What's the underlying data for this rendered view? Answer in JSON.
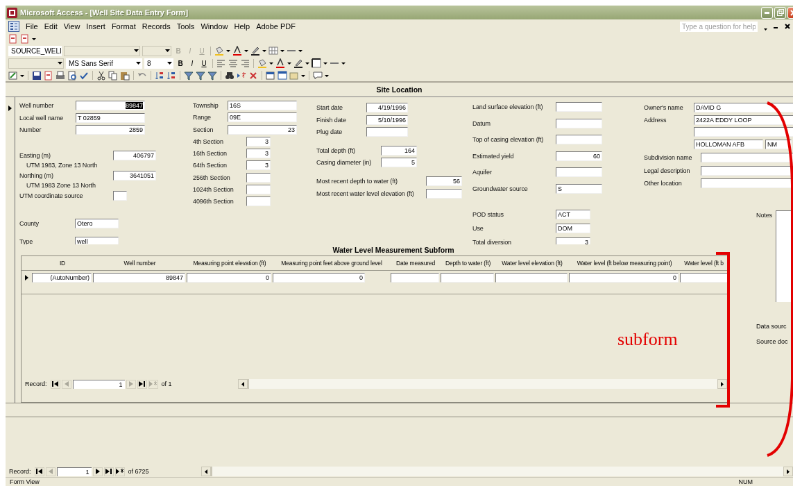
{
  "window": {
    "title": "Microsoft Access - [Well Site Data Entry Form]"
  },
  "menu": [
    {
      "label": "File"
    },
    {
      "label": "Edit"
    },
    {
      "label": "View"
    },
    {
      "label": "Insert"
    },
    {
      "label": "Format"
    },
    {
      "label": "Records"
    },
    {
      "label": "Tools"
    },
    {
      "label": "Window"
    },
    {
      "label": "Help"
    },
    {
      "label": "Adobe PDF"
    }
  ],
  "help_box": {
    "placeholder": "Type a question for help"
  },
  "object_combo": {
    "value": "SOURCE_WELI"
  },
  "font_combo": {
    "value": "MS Sans Serif"
  },
  "size_combo": {
    "value": "8"
  },
  "style_buttons_1": [
    {
      "label": "B",
      "disabled": true
    },
    {
      "label": "I",
      "disabled": true
    },
    {
      "label": "U",
      "disabled": true
    }
  ],
  "style_buttons_2": [
    {
      "label": "B",
      "disabled": false
    },
    {
      "label": "I",
      "disabled": false
    },
    {
      "label": "U",
      "disabled": false
    }
  ],
  "form": {
    "header": "Site Location",
    "columns": [
      {
        "groups": [
          [
            {
              "label": "Well number",
              "value": "89847",
              "kind": "number",
              "focused": true
            },
            {
              "label": "Local well name",
              "value": "T 02859",
              "kind": "text",
              "focused": false
            },
            {
              "label": "Number",
              "value": "2859",
              "kind": "number",
              "focused": false
            }
          ],
          [
            {
              "label": "Easting (m)",
              "sublabel": "UTM 1983, Zone 13 North",
              "value": "406797",
              "kind": "number",
              "focused": false
            },
            {
              "label": "Northing (m)",
              "sublabel": "UTM 1983 Zone 13 North",
              "value": "3641051",
              "kind": "number",
              "focused": false
            },
            {
              "label": "UTM coordinate source",
              "kind": "text",
              "focused": false
            }
          ],
          [
            {
              "label": "County",
              "value": "Otero",
              "kind": "text",
              "focused": false
            },
            {
              "label": "Type",
              "value": "well",
              "kind": "text",
              "focused": false
            }
          ]
        ]
      },
      {
        "groups": [
          [
            {
              "label": "Township",
              "value": "16S",
              "kind": "text",
              "focused": false
            },
            {
              "label": "Range",
              "value": "09E",
              "kind": "text",
              "focused": false
            },
            {
              "label": "Section",
              "value": "23",
              "kind": "number",
              "focused": false
            }
          ],
          [
            {
              "label": "4th Section",
              "value": "3",
              "kind": "number",
              "focused": false
            },
            {
              "label": "16th Section",
              "value": "3",
              "kind": "number",
              "focused": false
            },
            {
              "label": "64th Section",
              "value": "3",
              "kind": "number",
              "focused": false
            },
            {
              "label": "256th Section",
              "kind": "number",
              "focused": false
            },
            {
              "label": "1024th Section",
              "kind": "number",
              "focused": false
            },
            {
              "label": "4096th Section",
              "kind": "number",
              "focused": false
            }
          ]
        ]
      },
      {
        "groups": [
          [
            {
              "label": "Start date",
              "value": "4/19/1996",
              "kind": "date",
              "focused": false
            },
            {
              "label": "Finish date",
              "value": "5/10/1996",
              "kind": "date",
              "focused": false
            },
            {
              "label": "Plug date",
              "kind": "date",
              "focused": false
            }
          ],
          [
            {
              "label": "Total depth (ft)",
              "value": "164",
              "kind": "number",
              "focused": false
            },
            {
              "label": "Casing diameter (in)",
              "value": "5",
              "kind": "number",
              "focused": false
            }
          ],
          [
            {
              "label": "Most recent depth to water (ft)",
              "value": "56",
              "kind": "number",
              "focused": false
            },
            {
              "label": "Most recent water level elevation (ft)",
              "kind": "number",
              "focused": false
            }
          ]
        ]
      },
      {
        "groups": [
          [
            {
              "label": "Land surface elevation (ft)",
              "kind": "number",
              "focused": false
            },
            {
              "label": "Datum",
              "kind": "text",
              "focused": false
            },
            {
              "label": "Top of casing elevation (ft)",
              "kind": "number",
              "focused": false
            },
            {
              "label": "Estimated yield",
              "value": "60",
              "kind": "number",
              "focused": false
            },
            {
              "label": "Aquifer",
              "kind": "text",
              "focused": false
            },
            {
              "label": "Groundwater source",
              "value": "S",
              "kind": "text",
              "focused": false
            }
          ],
          [
            {
              "label": "POD status",
              "value": "ACT",
              "kind": "text",
              "focused": false
            },
            {
              "label": "Use",
              "value": "DOM",
              "kind": "text",
              "focused": false
            },
            {
              "label": "Total diversion",
              "value": "3",
              "kind": "number",
              "focused": false
            }
          ]
        ]
      },
      {
        "groups": [
          [
            {
              "label": "Owner's name",
              "value": "DAVID G",
              "kind": "text",
              "focused": false
            },
            {
              "label": "Address",
              "value": "2422A EDDY LOOP",
              "kind": "text",
              "focused": false
            },
            {
              "kind": "text",
              "focused": false
            },
            {
              "value": "HOLLOMAN AFB",
              "second_value": "NM",
              "kind": "text",
              "focused": false
            }
          ],
          [
            {
              "label": "Subdivision name",
              "kind": "text",
              "focused": false
            },
            {
              "label": "Legal description",
              "kind": "text",
              "focused": false
            },
            {
              "label": "Other location",
              "kind": "text",
              "focused": false
            }
          ]
        ]
      }
    ]
  },
  "notes": {
    "label": "Notes"
  },
  "side_labels": [
    "Data sourc",
    "Source doc"
  ],
  "subform": {
    "title": "Water Level Measurement Subform",
    "columns": [
      "ID",
      "Well number",
      "Measuring point elevation (ft)",
      "Measuring point feet above ground level",
      "Date measured",
      "Depth to water (ft)",
      "Water level elevation (ft)",
      "Water level (ft below measuring point)",
      "Water level (ft b"
    ],
    "rows": [
      {
        "cells": [
          {
            "value": "(AutoNumber)"
          },
          {
            "value": "89847"
          },
          {
            "value": "0"
          },
          {
            "value": "0"
          },
          {},
          {},
          {},
          {
            "value": "0"
          },
          {}
        ]
      }
    ],
    "navigation": {
      "label": "Record:",
      "current": "1",
      "total": "of 1",
      "buttons": [
        {
          "disabled": false
        },
        {
          "disabled": true
        },
        {
          "disabled": true
        },
        {
          "disabled": false
        },
        {
          "disabled": true
        }
      ]
    }
  },
  "navigation": {
    "label": "Record:",
    "current": "1",
    "total": "of 6725",
    "buttons": [
      {
        "disabled": false
      },
      {
        "disabled": true
      },
      {
        "disabled": false
      },
      {
        "disabled": false
      },
      {
        "disabled": false
      }
    ]
  },
  "status_bar": {
    "left": "Form View",
    "right": "NUM"
  },
  "annotations": [
    {
      "label": "subform"
    }
  ]
}
